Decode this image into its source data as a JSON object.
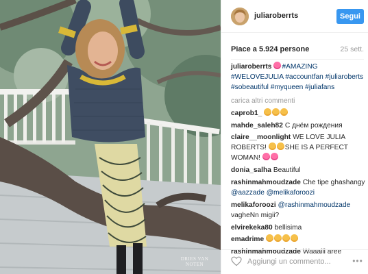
{
  "post": {
    "username": "juliaroberrts",
    "follow_label": "Segui",
    "likes": "Piace a 5.924 persone",
    "date": "25 sett.",
    "caption": {
      "user": "juliaroberrts",
      "text": "#AMAZING #WELOVEJULIA #accountfan #juliaroberts #sobeautiful #myqueen #juliafans"
    },
    "load_more": "carica altri commenti",
    "comments": [
      {
        "user": "caprob1_",
        "text": ""
      },
      {
        "user": "mahde_saleh82",
        "text": "С днём рождения"
      },
      {
        "user": "claire__moonlight",
        "text": "WE LOVE JULIA ROBERTS!",
        "text2": "SHE IS A PERFECT WOMAN!"
      },
      {
        "user": "donia_salha",
        "text": "Beautiful"
      },
      {
        "user": "rashinmahmoudzade",
        "text": "Che tipe ghashangy",
        "mention1": "@aazzade",
        "mention2": "@melikaforoozi"
      },
      {
        "user": "melikaforoozi",
        "mention1": "@rashinmahmoudzade",
        "text": "vagheNn migii?"
      },
      {
        "user": "elvirekeka80",
        "text": "bellisima"
      },
      {
        "user": "emadrime",
        "text": ""
      },
      {
        "user": "rashinmahmoudzade",
        "text": "Waaaiii aree"
      }
    ],
    "comment_placeholder": "Aggiungi un commento...",
    "more_label": "•••",
    "watermark": {
      "line1": "DRIES VAN",
      "line2": "NOTEN"
    }
  },
  "icons": {
    "like": "heart-outline-icon",
    "more": "more-horizontal-icon",
    "emoji": "smiley-face-icon"
  },
  "colors": {
    "accent": "#3897f0",
    "mention": "#003569",
    "muted": "#999999"
  }
}
